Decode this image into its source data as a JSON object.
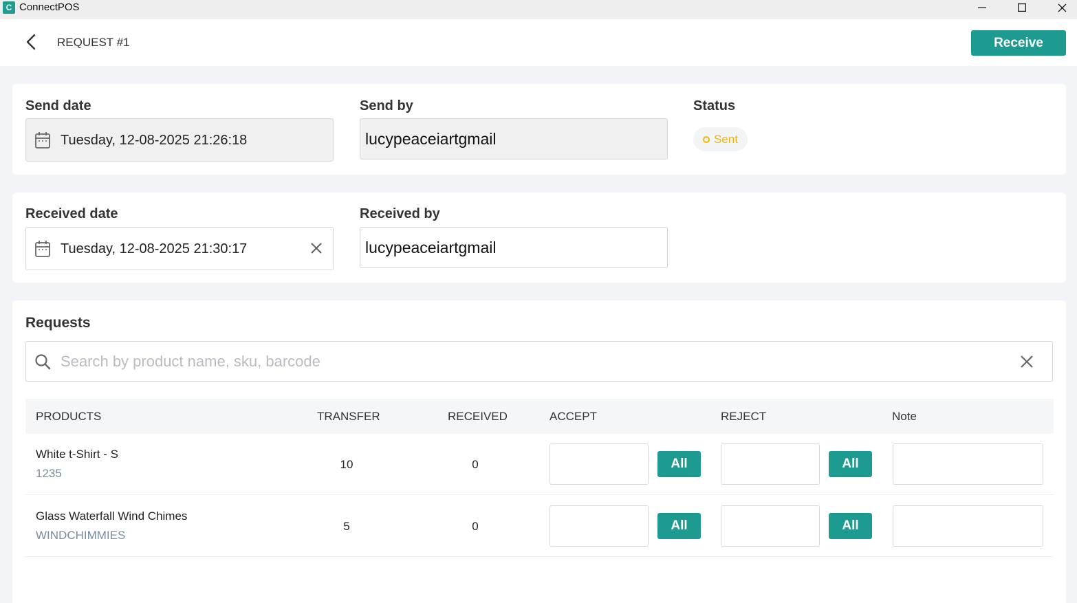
{
  "window": {
    "app_title": "ConnectPOS",
    "logo_glyph": "C"
  },
  "header": {
    "title": "REQUEST #1",
    "receive_label": "Receive"
  },
  "send": {
    "date_label": "Send date",
    "date_value": "Tuesday, 12-08-2025 21:26:18",
    "by_label": "Send by",
    "by_value": "lucypeaceiartgmail",
    "status_label": "Status",
    "status_value": "Sent"
  },
  "receive": {
    "date_label": "Received date",
    "date_value": "Tuesday, 12-08-2025 21:30:17",
    "by_label": "Received by",
    "by_value": "lucypeaceiartgmail"
  },
  "requests": {
    "title": "Requests",
    "search_placeholder": "Search by product name, sku, barcode",
    "columns": [
      "PRODUCTS",
      "TRANSFER",
      "RECEIVED",
      "ACCEPT",
      "REJECT",
      "Note"
    ],
    "all_label": "All",
    "rows": [
      {
        "name": "White t-Shirt - S",
        "sku": "1235",
        "transfer": "10",
        "received": "0"
      },
      {
        "name": "Glass Waterfall Wind Chimes",
        "sku": "WINDCHIMMIES",
        "transfer": "5",
        "received": "0"
      }
    ]
  },
  "colors": {
    "accent": "#1d9b91",
    "status_sent": "#f5b400",
    "sku": "#7a8ba3"
  }
}
